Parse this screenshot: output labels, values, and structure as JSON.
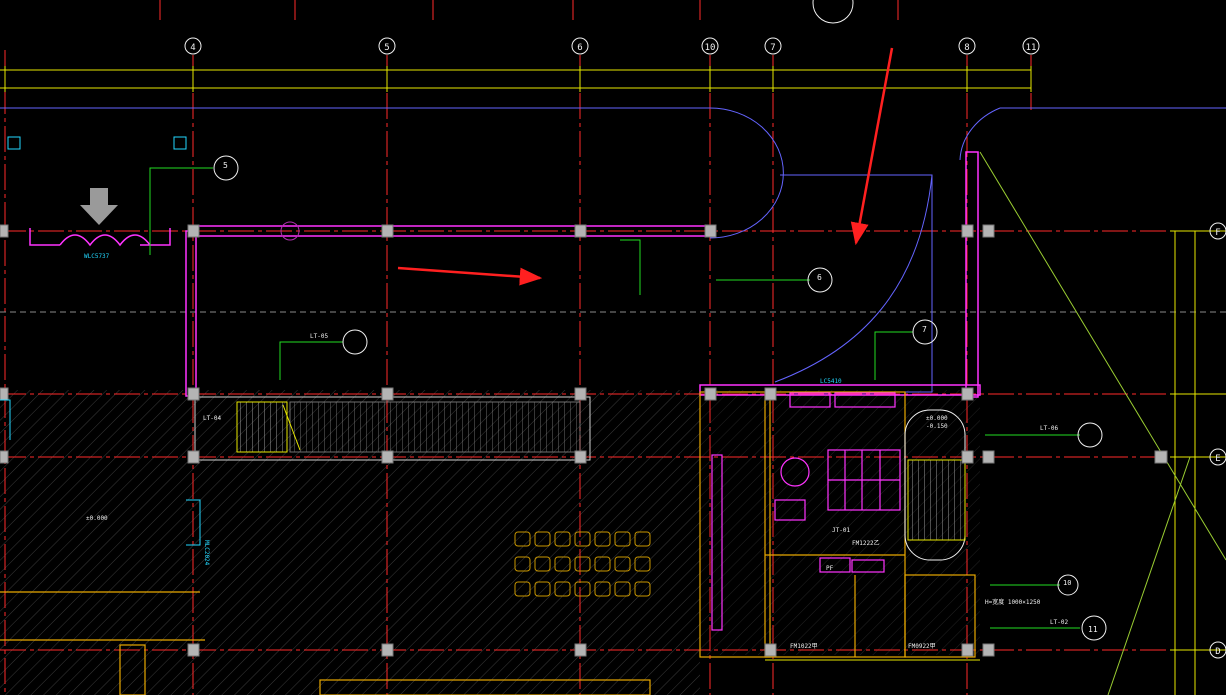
{
  "canvas": {
    "background": "#000000"
  },
  "axes_top": {
    "labels": [
      "4",
      "5",
      "6",
      "10",
      "7",
      "8",
      "11"
    ]
  },
  "axes_right": {
    "labels": [
      "F",
      "E",
      "D"
    ]
  },
  "texts": {
    "wlc": "WLC5737",
    "lt04": "LT-04",
    "lt05": "LT-05",
    "lt06": "LT-06",
    "lt02": "LT-02",
    "elev_a": "±0.000",
    "elev_b": "±0.000",
    "elev_c": "-0.150",
    "fm_a": "FM1022甲",
    "fm_b": "FM0922甲",
    "fm_c": "FM1222乙",
    "pf": "PF",
    "zd": "JT-01",
    "size": "H=宽度 1000×1250",
    "ls": "LC5410",
    "mlc": "MLC2024",
    "bubble5": "5",
    "bubble6": "6",
    "bubble7": "7",
    "bubble10": "10",
    "bubble11": "11"
  },
  "colors": {
    "grid_red": "#ff2a2a",
    "wall_magenta": "#ff33ff",
    "dim_yellow": "#e8e800",
    "green": "#22dd22",
    "cyan": "#22d8ff",
    "blue": "#6464ff",
    "white": "#f0f0f0",
    "orange": "#e8a800",
    "arrow_red": "#ff2020"
  }
}
